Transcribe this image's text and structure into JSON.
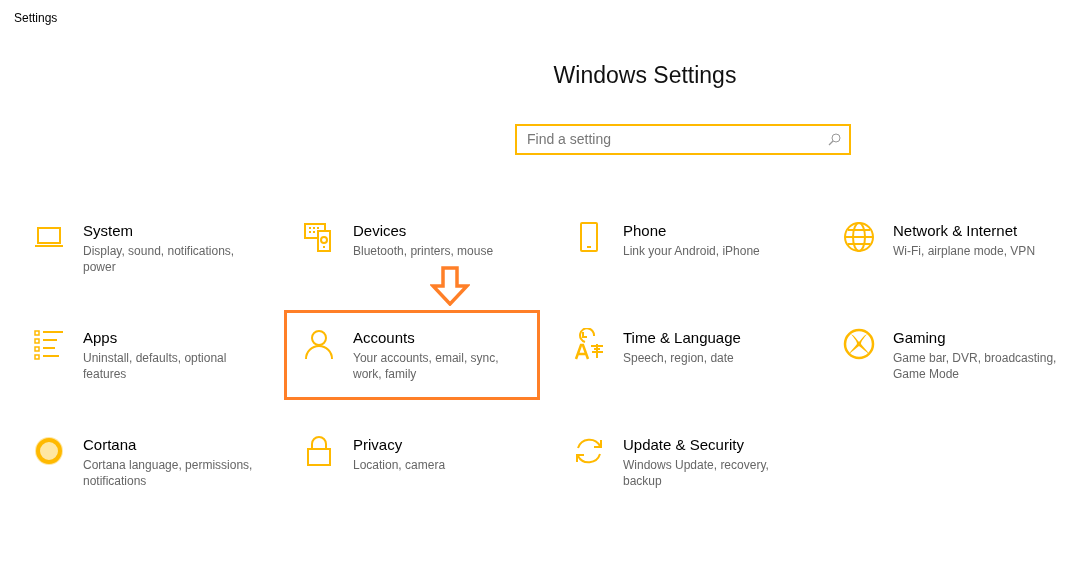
{
  "window": {
    "title": "Settings"
  },
  "heading": "Windows Settings",
  "search": {
    "placeholder": "Find a setting"
  },
  "tiles": [
    {
      "kind": "laptop",
      "title": "System",
      "description": "Display, sound, notifications, power",
      "highlighted": false
    },
    {
      "kind": "devices",
      "title": "Devices",
      "description": "Bluetooth, printers, mouse",
      "highlighted": false
    },
    {
      "kind": "phone",
      "title": "Phone",
      "description": "Link your Android, iPhone",
      "highlighted": false
    },
    {
      "kind": "globe",
      "title": "Network & Internet",
      "description": "Wi-Fi, airplane mode, VPN",
      "highlighted": false
    },
    {
      "kind": "list",
      "title": "Apps",
      "description": "Uninstall, defaults, optional features",
      "highlighted": false
    },
    {
      "kind": "person",
      "title": "Accounts",
      "description": "Your accounts, email, sync, work, family",
      "highlighted": true
    },
    {
      "kind": "clock",
      "title": "Time & Language",
      "description": "Speech, region, date",
      "highlighted": false
    },
    {
      "kind": "xbox",
      "title": "Gaming",
      "description": "Game bar, DVR, broadcasting, Game Mode",
      "highlighted": false
    },
    {
      "kind": "ring",
      "title": "Cortana",
      "description": "Cortana language, permissions, notifications",
      "highlighted": false
    },
    {
      "kind": "lock",
      "title": "Privacy",
      "description": "Location, camera",
      "highlighted": false
    },
    {
      "kind": "sync",
      "title": "Update & Security",
      "description": "Windows Update, recovery, backup",
      "highlighted": false
    }
  ]
}
